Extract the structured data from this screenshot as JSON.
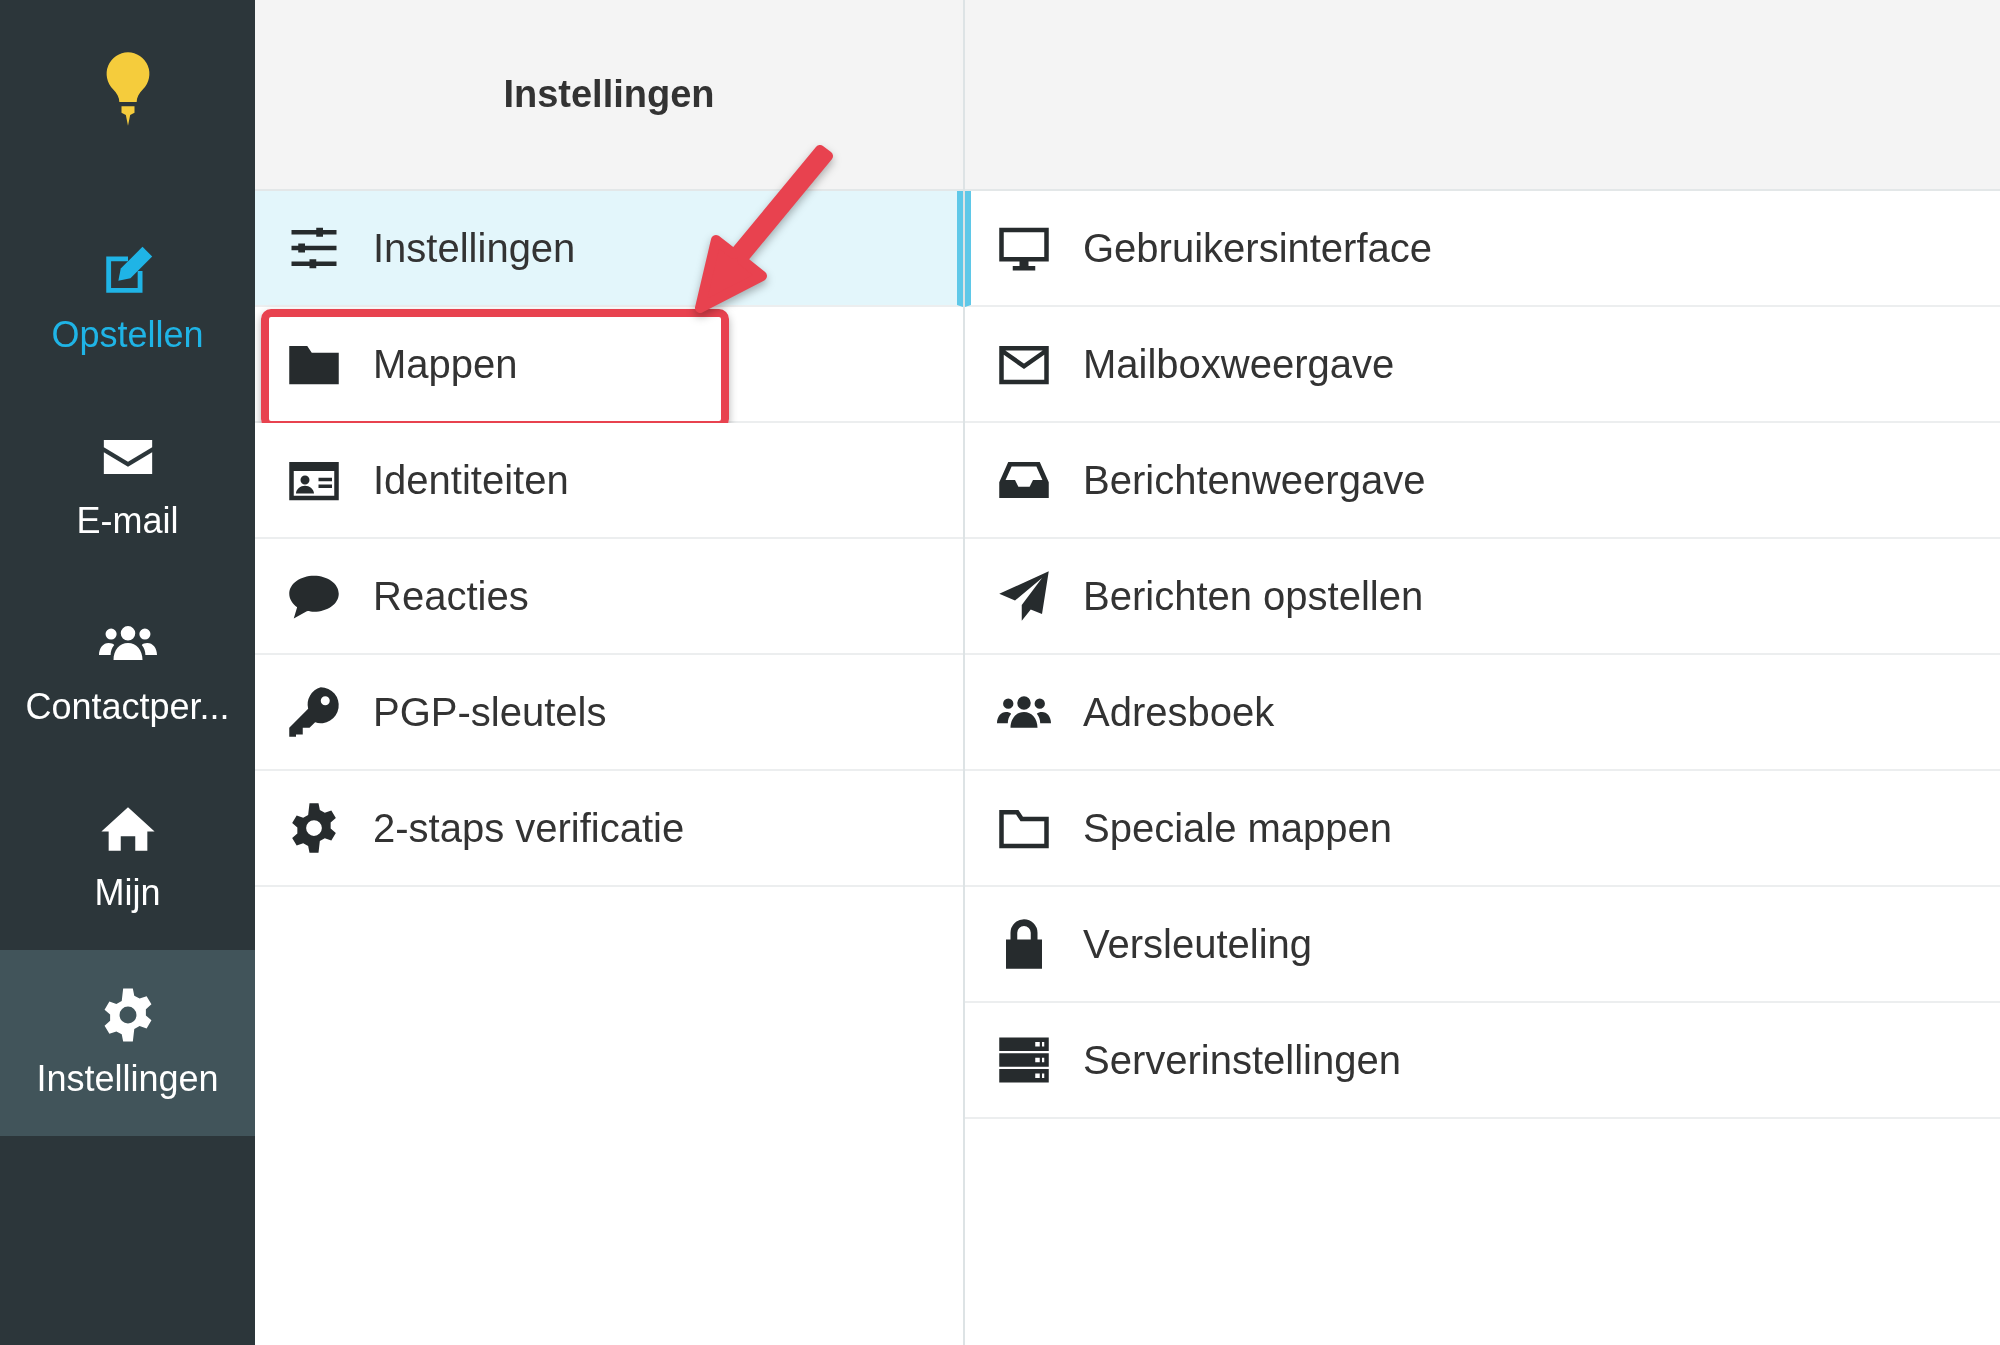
{
  "nav": [
    {
      "label": "Opstellen",
      "kind": "compose",
      "selected": false
    },
    {
      "label": "E-mail",
      "kind": "normal",
      "selected": false
    },
    {
      "label": "Contactper...",
      "kind": "normal",
      "selected": false
    },
    {
      "label": "Mijn",
      "kind": "normal",
      "selected": false
    },
    {
      "label": "Instellingen",
      "kind": "normal",
      "selected": true
    }
  ],
  "sections": {
    "title": "Instellingen",
    "items": [
      {
        "label": "Instellingen",
        "selected": true,
        "highlighted": false
      },
      {
        "label": "Mappen",
        "selected": false,
        "highlighted": true
      },
      {
        "label": "Identiteiten",
        "selected": false,
        "highlighted": false
      },
      {
        "label": "Reacties",
        "selected": false,
        "highlighted": false
      },
      {
        "label": "PGP-sleutels",
        "selected": false,
        "highlighted": false
      },
      {
        "label": "2-staps verificatie",
        "selected": false,
        "highlighted": false
      }
    ]
  },
  "preferences": {
    "items": [
      {
        "label": "Gebruikersinterface"
      },
      {
        "label": "Mailboxweergave"
      },
      {
        "label": "Berichtenweergave"
      },
      {
        "label": "Berichten opstellen"
      },
      {
        "label": "Adresboek"
      },
      {
        "label": "Speciale mappen"
      },
      {
        "label": "Versleuteling"
      },
      {
        "label": "Serverinstellingen"
      }
    ]
  }
}
